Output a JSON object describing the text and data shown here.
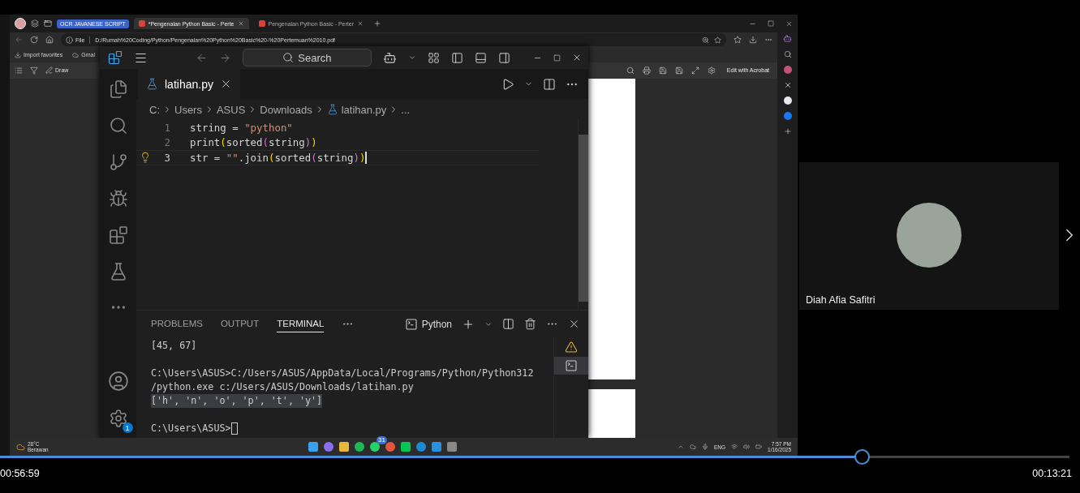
{
  "browser": {
    "tab_group": "OCR JAVANESE SCRIPT",
    "tabs": [
      {
        "title": "*Pengenalan Python Basic - Perte",
        "selected": true
      },
      {
        "title": "Pengenalan Python Basic - Perter",
        "selected": false
      }
    ],
    "address": {
      "scheme": "File",
      "url": "D:/Rumah%20Coding/Python/Pengenalan%20Python%20Basic%20-%20Pertemuan%2010.pdf"
    },
    "favorites": [
      "Import favorites",
      "Gmai"
    ],
    "draw": "Draw",
    "edit_button": "Edit with Acrobat"
  },
  "vscode": {
    "search": "Search",
    "editor_tab": {
      "title": "latihan.py",
      "selected": true
    },
    "breadcrumb": [
      "C:",
      "Users",
      "ASUS",
      "Downloads",
      "latihan.py",
      "..."
    ],
    "lines": [
      {
        "number": "1",
        "hint": false,
        "cursor": false,
        "tokens": [
          {
            "text": "string = ",
            "kind": "plain"
          },
          {
            "text": "\"python\"",
            "kind": "string"
          }
        ]
      },
      {
        "number": "2",
        "hint": false,
        "cursor": false,
        "tokens": [
          {
            "text": "print",
            "kind": "plain"
          },
          {
            "text": "(",
            "kind": "bracket1"
          },
          {
            "text": "sorted",
            "kind": "plain"
          },
          {
            "text": "(",
            "kind": "bracket2"
          },
          {
            "text": "string",
            "kind": "plain"
          },
          {
            "text": ")",
            "kind": "bracket2"
          },
          {
            "text": ")",
            "kind": "bracket1"
          }
        ]
      },
      {
        "number": "3",
        "hint": true,
        "cursor": true,
        "tokens": [
          {
            "text": "str = ",
            "kind": "plain"
          },
          {
            "text": "\"\"",
            "kind": "string"
          },
          {
            "text": ".join",
            "kind": "plain"
          },
          {
            "text": "(",
            "kind": "bracket1"
          },
          {
            "text": "sorted",
            "kind": "plain"
          },
          {
            "text": "(",
            "kind": "bracket2"
          },
          {
            "text": "string",
            "kind": "plain"
          },
          {
            "text": ")",
            "kind": "bracket2"
          },
          {
            "text": ")",
            "kind": "bracket1"
          }
        ]
      }
    ],
    "panel_tabs": [
      {
        "label": "PROBLEMS",
        "selected": false
      },
      {
        "label": "OUTPUT",
        "selected": false
      },
      {
        "label": "TERMINAL",
        "selected": true
      }
    ],
    "terminal_name": "Python",
    "terminal_blocks": [
      {
        "lines": [
          {
            "text": "[45, 67]",
            "kind": "output",
            "selected": false
          }
        ]
      },
      {
        "lines": [
          {
            "text": "C:\\Users\\ASUS>C:/Users/ASUS/AppData/Local/Programs/Python/Python312",
            "kind": "output",
            "selected": false
          },
          {
            "text": "/python.exe c:/Users/ASUS/Downloads/latihan.py",
            "kind": "output",
            "selected": false
          },
          {
            "text": "['h', 'n', 'o', 'p', 't', 'y']",
            "kind": "output",
            "selected": true
          }
        ]
      },
      {
        "lines": [
          {
            "text": "C:\\Users\\ASUS>",
            "kind": "prompt",
            "selected": false
          }
        ]
      }
    ],
    "settings_badge": "1"
  },
  "taskbar": {
    "temperature": "28°C",
    "weather": "Berawan",
    "chat_badge": "31",
    "language": "ENG",
    "time": "7:57 PM",
    "date": "1/16/2025"
  },
  "participant": {
    "name": "Diah Afia Safitri"
  },
  "player": {
    "elapsed": "00:56:59",
    "remaining": "00:13:21",
    "level": 0.806
  }
}
